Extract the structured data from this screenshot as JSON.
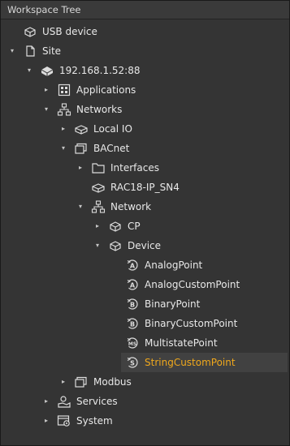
{
  "panel": {
    "title": "Workspace Tree"
  },
  "tree": {
    "usb_device": "USB device",
    "site": "Site",
    "ip": "192.168.1.52:88",
    "applications": "Applications",
    "networks": "Networks",
    "local_io": "Local IO",
    "bacnet": "BACnet",
    "interfaces": "Interfaces",
    "rac18": "RAC18-IP_SN4",
    "network": "Network",
    "cp": "CP",
    "device": "Device",
    "analog_point": "AnalogPoint",
    "analog_custom_point": "AnalogCustomPoint",
    "binary_point": "BinaryPoint",
    "binary_custom_point": "BinaryCustomPoint",
    "multistate_point": "MultistatePoint",
    "string_custom_point": "StringCustomPoint",
    "modbus": "Modbus",
    "services": "Services",
    "system": "System"
  },
  "colors": {
    "selected_text": "#f0a81c",
    "selected_bg": "#414141"
  }
}
